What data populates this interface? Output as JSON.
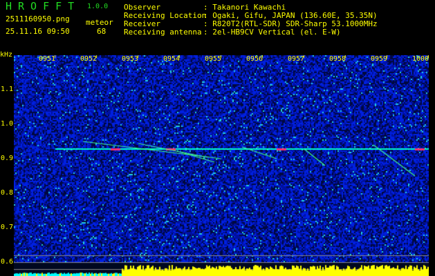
{
  "app": {
    "title": "HROFFT",
    "version": "1.0.0"
  },
  "file": {
    "name": "2511160950.png",
    "datetime": "25.11.16 09:50"
  },
  "meteor": {
    "label": "meteor",
    "count": "68"
  },
  "info": [
    {
      "label": "Observer",
      "value": ": Takanori Kawachi"
    },
    {
      "label": "Receiving Location",
      "value": ": Ogaki, Gifu, JAPAN (136.60E, 35.35N)"
    },
    {
      "label": "Receiver",
      "value": ": R820T2(RTL-SDR) SDR-Sharp 53.1000MHz"
    },
    {
      "label": "Receiving antenna",
      "value": ": 2el-HB9CV Vertical (el. E-W)"
    }
  ],
  "axis": {
    "unit": "kHz",
    "time_labels": [
      "0951",
      "0952",
      "0953",
      "0954",
      "0955",
      "0956",
      "0957",
      "0958",
      "0959",
      "1000"
    ],
    "freq_labels": [
      "1.1",
      "1.0",
      "0.9",
      "0.8",
      "0.7",
      "0.6"
    ]
  },
  "colors": {
    "text": "#ffff00",
    "title": "#22dd22",
    "noise": "#0018c8",
    "carrier": "#00ffcc"
  }
}
